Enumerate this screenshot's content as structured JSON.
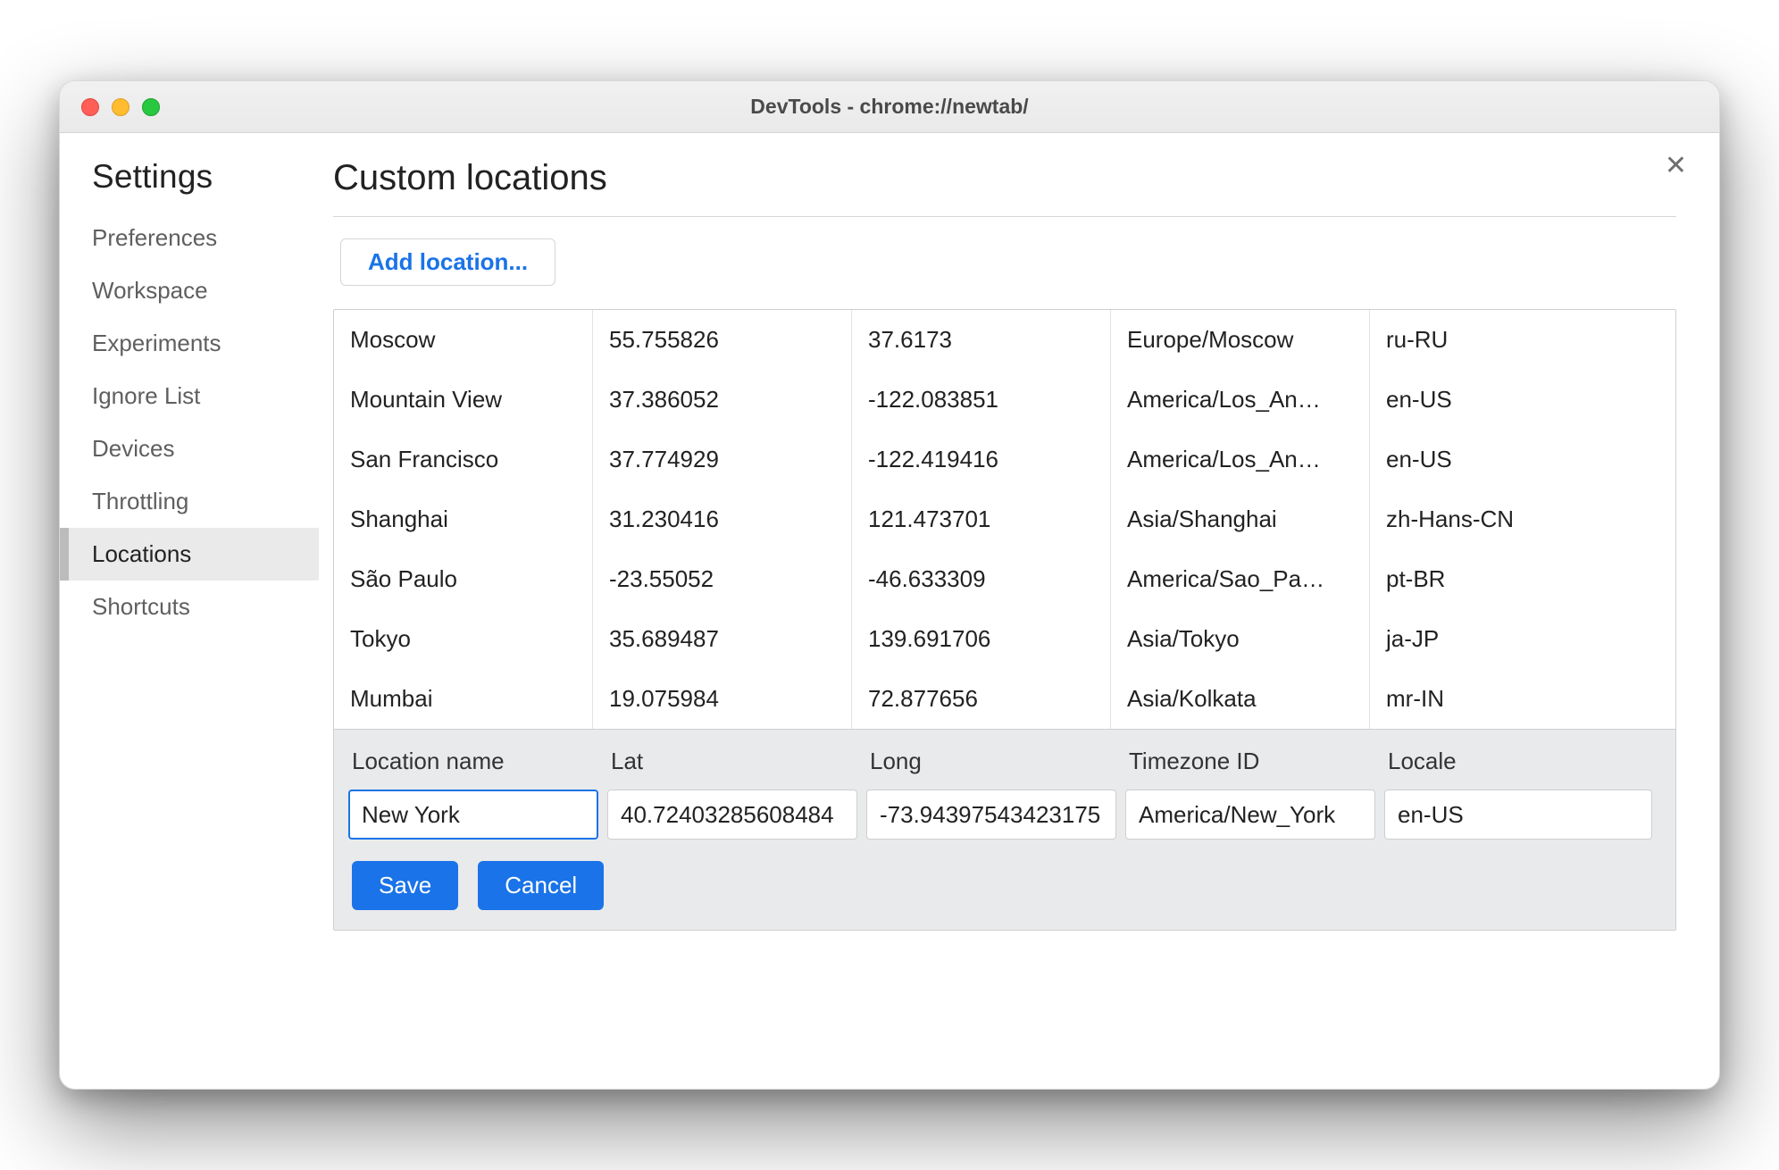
{
  "window": {
    "title": "DevTools - chrome://newtab/"
  },
  "close_icon": "✕",
  "sidebar": {
    "heading": "Settings",
    "items": [
      {
        "label": "Preferences",
        "active": false
      },
      {
        "label": "Workspace",
        "active": false
      },
      {
        "label": "Experiments",
        "active": false
      },
      {
        "label": "Ignore List",
        "active": false
      },
      {
        "label": "Devices",
        "active": false
      },
      {
        "label": "Throttling",
        "active": false
      },
      {
        "label": "Locations",
        "active": true
      },
      {
        "label": "Shortcuts",
        "active": false
      }
    ]
  },
  "page": {
    "title": "Custom locations",
    "add_button_label": "Add location..."
  },
  "locations": [
    {
      "name": "Moscow",
      "lat": "55.755826",
      "long": "37.6173",
      "tz": "Europe/Moscow",
      "locale": "ru-RU"
    },
    {
      "name": "Mountain View",
      "lat": "37.386052",
      "long": "-122.083851",
      "tz": "America/Los_An…",
      "locale": "en-US"
    },
    {
      "name": "San Francisco",
      "lat": "37.774929",
      "long": "-122.419416",
      "tz": "America/Los_An…",
      "locale": "en-US"
    },
    {
      "name": "Shanghai",
      "lat": "31.230416",
      "long": "121.473701",
      "tz": "Asia/Shanghai",
      "locale": "zh-Hans-CN"
    },
    {
      "name": "São Paulo",
      "lat": "-23.55052",
      "long": "-46.633309",
      "tz": "America/Sao_Pa…",
      "locale": "pt-BR"
    },
    {
      "name": "Tokyo",
      "lat": "35.689487",
      "long": "139.691706",
      "tz": "Asia/Tokyo",
      "locale": "ja-JP"
    },
    {
      "name": "Mumbai",
      "lat": "19.075984",
      "long": "72.877656",
      "tz": "Asia/Kolkata",
      "locale": "mr-IN"
    }
  ],
  "editor": {
    "labels": {
      "name": "Location name",
      "lat": "Lat",
      "long": "Long",
      "tz": "Timezone ID",
      "locale": "Locale"
    },
    "values": {
      "name": "New York",
      "lat": "40.72403285608484",
      "long": "-73.94397543423175",
      "tz": "America/New_York",
      "locale": "en-US"
    },
    "buttons": {
      "save": "Save",
      "cancel": "Cancel"
    }
  }
}
